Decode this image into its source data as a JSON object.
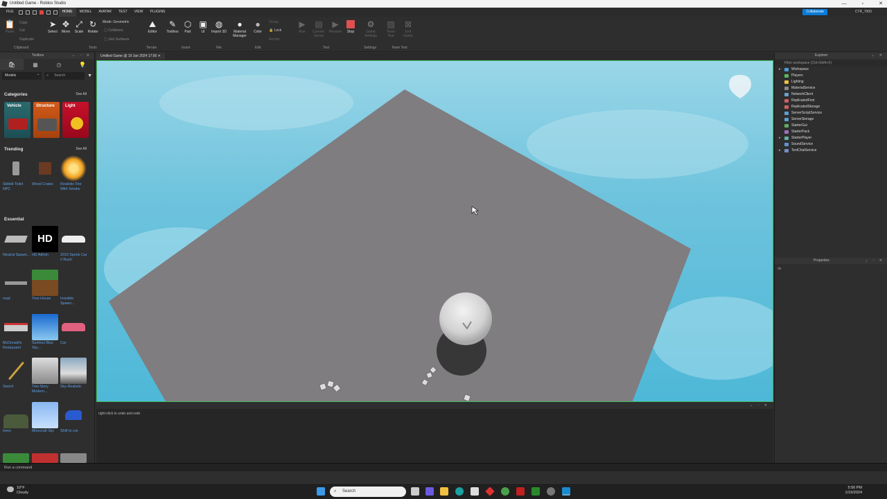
{
  "window": {
    "title": "Untitled Game - Roblox Studio"
  },
  "menubar": {
    "menus": [
      "FILE",
      "HOME",
      "MODEL",
      "AVATAR",
      "TEST",
      "VIEW",
      "PLUGINS"
    ],
    "active": "HOME",
    "collaborate": "Collaborate",
    "username": "CTR_7000"
  },
  "ribbon": {
    "clipboard": {
      "paste": "Paste",
      "copy": "Copy",
      "cut": "Cut",
      "duplicate": "Duplicate",
      "group": "Clipboard"
    },
    "tools": {
      "select": "Select",
      "move": "Move",
      "scale": "Scale",
      "rotate": "Rotate",
      "mode_label": "Mode:",
      "mode_value": "Geometric",
      "collisions": "Collisions",
      "join": "Join Surfaces",
      "group": "Tools"
    },
    "terrain": {
      "editor": "Editor",
      "group": "Terrain"
    },
    "insert": {
      "toolbox": "Toolbox",
      "part": "Part",
      "ui": "UI",
      "group": "Insert"
    },
    "file": {
      "import3d": "Import 3D",
      "group": "File"
    },
    "edit": {
      "material": "Material Manager",
      "color": "Color",
      "groupbtn": "Group",
      "lock": "Lock",
      "anchor": "Anchor",
      "group": "Edit"
    },
    "test": {
      "run": "Run",
      "current_client": "Current: Server",
      "resume": "Resume",
      "stop": "Stop",
      "group": "Test"
    },
    "settings": {
      "game_settings": "Game Settings",
      "group": "Settings"
    },
    "team_test": {
      "team_test": "Team Test",
      "exit_game": "Exit Game",
      "group": "Team Test"
    }
  },
  "toolbox": {
    "title": "Toolbox",
    "category_select": "Models",
    "search_placeholder": "Search",
    "categories_title": "Categories",
    "see_all": "See All",
    "categories": [
      "Vehicle",
      "Structure",
      "Light"
    ],
    "trending_title": "Trending",
    "trending": [
      "Skibidi Toilet NPC",
      "Wood Crates",
      "Realistic Fire With Smoke"
    ],
    "essential_title": "Essential",
    "essential": [
      [
        "Neutral Spawn...",
        "HD Admin",
        "2019 Sports Car // Rush"
      ],
      [
        "road",
        "Tree House",
        "Invisible Spawn..."
      ],
      [
        "McDonald's Restaurant",
        "Sunless Blue Sky...",
        "Car"
      ],
      [
        "Sword",
        "Two-Story Modern...",
        "Sky-Realistic"
      ],
      [
        "trees",
        "Minecraft Sky",
        "Shift to run"
      ]
    ]
  },
  "viewport": {
    "tab": "Untitled Game @ 19 Jan 2024 17:56"
  },
  "output": {
    "message": "right-click to undo and redo"
  },
  "explorer": {
    "title": "Explorer",
    "filter": "Filter workspace (Ctrl+Shift+X)",
    "items": [
      {
        "name": "Workspace",
        "color": "#4a9de0",
        "expand": true
      },
      {
        "name": "Players",
        "color": "#5cb85c",
        "expand": false
      },
      {
        "name": "Lighting",
        "color": "#f0c040",
        "expand": false
      },
      {
        "name": "MaterialService",
        "color": "#8a8a8a",
        "expand": false
      },
      {
        "name": "NetworkClient",
        "color": "#6aa0d0",
        "expand": false
      },
      {
        "name": "ReplicatedFirst",
        "color": "#d06060",
        "expand": false
      },
      {
        "name": "ReplicatedStorage",
        "color": "#d06060",
        "expand": false
      },
      {
        "name": "ServerScriptService",
        "color": "#5ca0d0",
        "expand": false
      },
      {
        "name": "ServerStorage",
        "color": "#5ca0d0",
        "expand": false
      },
      {
        "name": "StarterGui",
        "color": "#60b060",
        "expand": false
      },
      {
        "name": "StarterPack",
        "color": "#a070c0",
        "expand": false
      },
      {
        "name": "StarterPlayer",
        "color": "#60b0a0",
        "expand": true
      },
      {
        "name": "SoundService",
        "color": "#6090d0",
        "expand": false
      },
      {
        "name": "TextChatService",
        "color": "#7090c0",
        "expand": true
      }
    ]
  },
  "properties": {
    "title": "Properties",
    "filter": "de"
  },
  "command": {
    "placeholder": "Run a command"
  },
  "taskbar": {
    "weather_temp": "10°F",
    "weather_desc": "Cloudy",
    "search": "Search",
    "time": "5:56 PM",
    "date": "1/19/2024"
  },
  "colors": {
    "sky": "#6ec3dd",
    "baseplate": "#7f7d80",
    "selection": "#3fbf62",
    "accent": "#0a7bd6"
  }
}
